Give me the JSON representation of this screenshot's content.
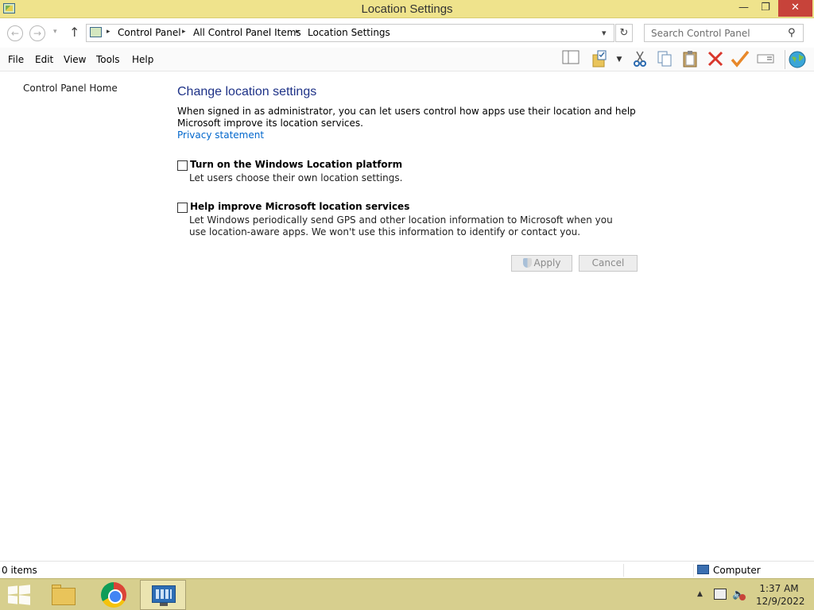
{
  "window": {
    "title": "Location Settings",
    "minimize_glyph": "—",
    "maximize_glyph": "❐",
    "close_glyph": "✕"
  },
  "nav": {
    "back_glyph": "←",
    "forward_glyph": "→",
    "up_glyph": "↑",
    "dropdown_glyph": "▾",
    "refresh_glyph": "↻",
    "breadcrumb": [
      "Control Panel",
      "All Control Panel Items",
      "Location Settings"
    ],
    "separator_glyph": "▸",
    "search_placeholder": "Search Control Panel",
    "search_glyph": "⚲"
  },
  "menu": {
    "items": [
      "File",
      "Edit",
      "View",
      "Tools",
      "Help"
    ]
  },
  "toolbar": {
    "icons": [
      "layout-pane-icon",
      "folder-properties-icon",
      "cut-icon",
      "copy-icon",
      "paste-icon",
      "delete-icon",
      "checkmark-icon",
      "rename-icon",
      "globe-icon"
    ]
  },
  "left_pane": {
    "home_link": "Control Panel Home"
  },
  "main": {
    "heading": "Change location settings",
    "intro": "When signed in as administrator, you can let users control how apps use their location and help Microsoft improve its location services.",
    "privacy_link": "Privacy statement",
    "options": [
      {
        "label": "Turn on the Windows Location platform",
        "description": "Let users choose their own location settings.",
        "checked": false
      },
      {
        "label": "Help improve Microsoft location services",
        "description": "Let Windows periodically send GPS and other location information to Microsoft when you use location-aware apps. We won't use this information to identify or contact you.",
        "checked": false
      }
    ],
    "apply_label": "Apply",
    "cancel_label": "Cancel"
  },
  "status_bar": {
    "items_count": "0 items",
    "location": "Computer"
  },
  "taskbar": {
    "apps": [
      "start-button",
      "file-explorer",
      "chrome",
      "control-panel"
    ],
    "tray_expand_glyph": "▲",
    "volume_glyph": "🔈",
    "time": "1:37 AM",
    "date": "12/9/2022"
  },
  "colors": {
    "title_bar": "#efe38c",
    "taskbar": "#d7cf8e",
    "heading": "#1e3287",
    "link": "#0066cc",
    "close_button": "#c7433a"
  }
}
